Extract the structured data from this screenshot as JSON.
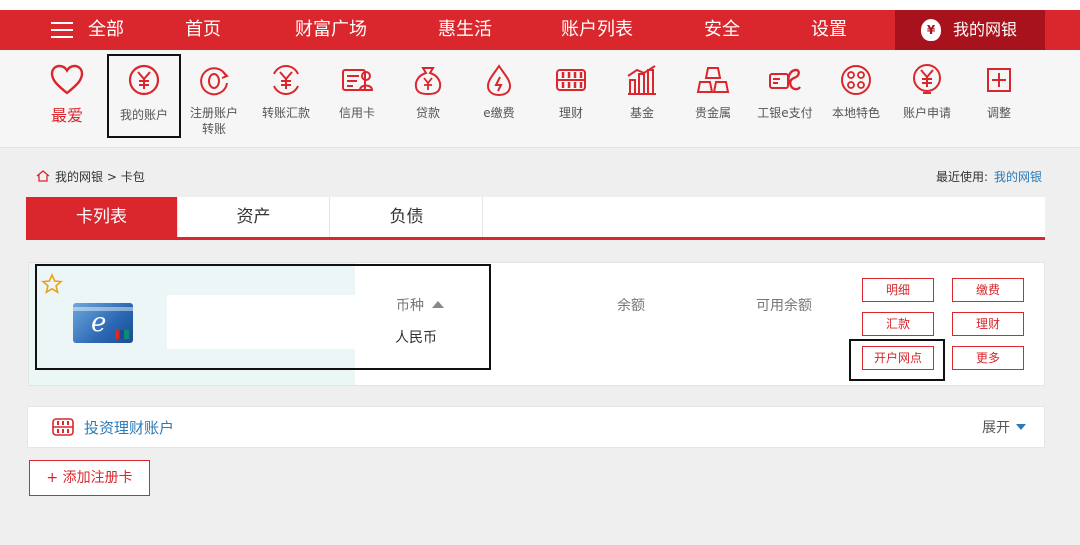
{
  "topnav": {
    "all_label": "全部",
    "items": [
      "首页",
      "财富广场",
      "惠生活",
      "账户列表",
      "安全",
      "设置"
    ],
    "mybank_label": "我的网银"
  },
  "iconbar": {
    "items": [
      {
        "label": "最爱",
        "icon": "heart-icon"
      },
      {
        "label": "我的账户",
        "icon": "yen-circle-icon"
      },
      {
        "label": "注册账户",
        "label2": "转账",
        "icon": "refresh-coin-icon"
      },
      {
        "label": "转账汇款",
        "icon": "yen-arrows-icon"
      },
      {
        "label": "信用卡",
        "icon": "credit-card-icon"
      },
      {
        "label": "贷款",
        "icon": "money-bag-icon"
      },
      {
        "label": "e缴费",
        "icon": "water-drop-icon"
      },
      {
        "label": "理财",
        "icon": "abacus-icon"
      },
      {
        "label": "基金",
        "icon": "bar-chart-icon"
      },
      {
        "label": "贵金属",
        "icon": "gold-bars-icon"
      },
      {
        "label": "工银e支付",
        "icon": "epay-icon"
      },
      {
        "label": "本地特色",
        "icon": "local-dots-icon"
      },
      {
        "label": "账户申请",
        "icon": "yen-apply-icon"
      },
      {
        "label": "调整",
        "icon": "plus-box-icon"
      }
    ]
  },
  "breadcrumb": {
    "home": "我的网银",
    "sep": ">",
    "current": "卡包"
  },
  "recent": {
    "label": "最近使用:",
    "link": "我的网银"
  },
  "tabs": [
    "卡列表",
    "资产",
    "负债"
  ],
  "card": {
    "currency_header": "币种",
    "currency_value": "人民币",
    "balance_header": "余额",
    "available_header": "可用余额",
    "actions": [
      "明细",
      "缴费",
      "汇款",
      "理财",
      "开户网点",
      "更多"
    ]
  },
  "invest": {
    "title": "投资理财账户",
    "expand": "展开"
  },
  "add_card": "+ 添加注册卡",
  "colors": {
    "brand_red": "#d9272d",
    "dark_red": "#a8121c",
    "link_blue": "#2a7ab8"
  }
}
